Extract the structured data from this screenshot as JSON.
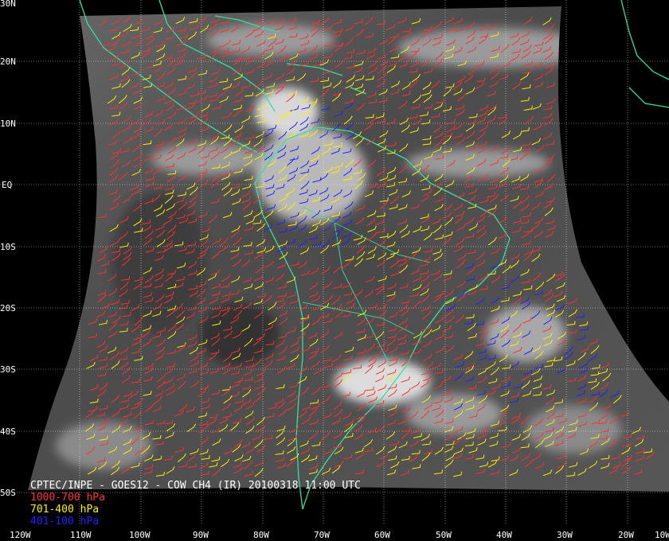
{
  "caption": {
    "title": "CPTEC/INPE - GOES12 - COW CH4 (IR) 20100318 11:00 UTC"
  },
  "legend": [
    {
      "label": "1000-700 hPa",
      "color": "#ff3030"
    },
    {
      "label": "701-400 hPa",
      "color": "#ffee00"
    },
    {
      "label": "401-100 hPa",
      "color": "#2020ff"
    }
  ],
  "axes": {
    "lat_labels": [
      "30N",
      "20N",
      "10N",
      "EQ",
      "10S",
      "20S",
      "30S",
      "40S",
      "50S"
    ],
    "lon_labels": [
      "120W",
      "110W",
      "100W",
      "90W",
      "80W",
      "70W",
      "60W",
      "50W",
      "40W",
      "30W",
      "20W",
      "10W"
    ]
  },
  "colors": {
    "coastline": "#33e0a0",
    "grid": "#ffffff",
    "background": "#000000"
  }
}
